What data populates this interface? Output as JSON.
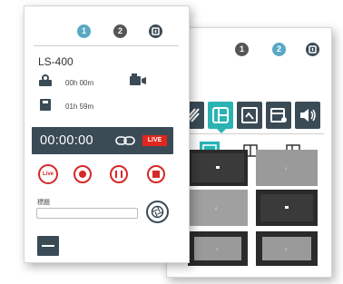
{
  "front_panel": {
    "tabs": [
      {
        "label": "1",
        "color": "#58a8c4"
      },
      {
        "label": "2",
        "color": "#555555"
      }
    ],
    "settings_icon": "exit-icon",
    "device_name": "LS-400",
    "recording_time": "00h 00m",
    "remaining_time": "01h 59m",
    "timer": "00:00:00",
    "live_badge": "LIVE",
    "live_button_label": "Live",
    "caption_label": "標題",
    "caption_value": "",
    "colors": {
      "accent": "#3b4b56",
      "record": "#d62828",
      "live": "#e0261d"
    }
  },
  "back_panel": {
    "tabs": [
      {
        "label": "1",
        "color": "#555555"
      },
      {
        "label": "2",
        "color": "#58a8c4"
      }
    ],
    "settings_icon": "exit-icon",
    "modes": [
      "pattern-icon",
      "layout-icon",
      "image-icon",
      "overlay-icon",
      "audio-icon"
    ],
    "active_mode": 1,
    "layout_options": [
      "single-layout",
      "side-by-side-layout",
      "pip-layout"
    ],
    "active_layout": 0,
    "grid_labels": [
      "1",
      "1",
      "2",
      "",
      "1",
      "2"
    ]
  }
}
